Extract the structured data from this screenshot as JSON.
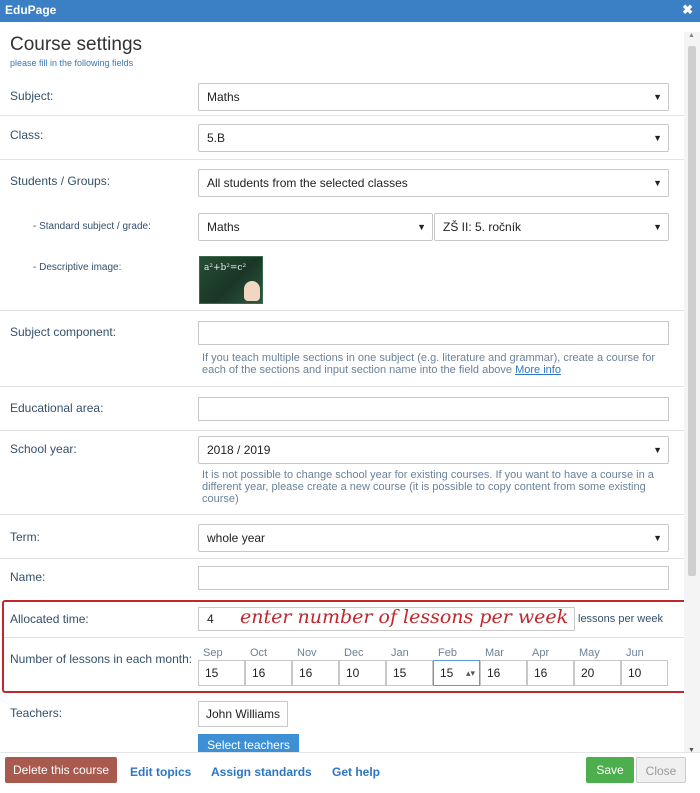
{
  "window": {
    "title": "EduPage"
  },
  "header": {
    "title": "Course settings",
    "subtitle": "please fill in the following fields"
  },
  "fields": {
    "subject": {
      "label": "Subject:",
      "value": "Maths"
    },
    "class": {
      "label": "Class:",
      "value": "5.B"
    },
    "students": {
      "label": "Students / Groups:",
      "value": "All students from the selected classes"
    },
    "standard": {
      "label": "- Standard subject / grade:",
      "subject_value": "Maths",
      "grade_value": "ZŠ II: 5. ročník"
    },
    "image": {
      "label": "- Descriptive image:",
      "chalk_text": "a²+b²=c²"
    },
    "component": {
      "label": "Subject component:",
      "value": "",
      "help": "If you teach multiple sections in one subject (e.g. literature and grammar), create a course for each of the sections and input section name into the field above",
      "help_link": "More info"
    },
    "edu_area": {
      "label": "Educational area:",
      "value": ""
    },
    "school_year": {
      "label": "School year:",
      "value": "2018 / 2019",
      "help": "It is not possible to change school year for existing courses. If you want to have a course in a different year, please create a new course (it is possible to copy content from some existing course)"
    },
    "term": {
      "label": "Term:",
      "value": "whole year"
    },
    "name": {
      "label": "Name:",
      "value": ""
    },
    "allocated": {
      "label": "Allocated time:",
      "value": "4",
      "suffix": "lessons per week",
      "annotation": "enter number of lessons per week"
    },
    "months": {
      "label": "Number of lessons in each month:",
      "items": [
        {
          "m": "Sep",
          "v": "15"
        },
        {
          "m": "Oct",
          "v": "16"
        },
        {
          "m": "Nov",
          "v": "16"
        },
        {
          "m": "Dec",
          "v": "10"
        },
        {
          "m": "Jan",
          "v": "15"
        },
        {
          "m": "Feb",
          "v": "15"
        },
        {
          "m": "Mar",
          "v": "16"
        },
        {
          "m": "Apr",
          "v": "16"
        },
        {
          "m": "May",
          "v": "20"
        },
        {
          "m": "Jun",
          "v": "10"
        }
      ]
    },
    "teachers": {
      "label": "Teachers:",
      "teacher": "John Williams",
      "select_btn": "Select teachers"
    }
  },
  "footer": {
    "delete": "Delete this course",
    "edit_topics": "Edit topics",
    "assign": "Assign standards",
    "help": "Get help",
    "save": "Save",
    "close": "Close"
  },
  "colors": {
    "titlebar": "#3b7fc4",
    "accent_red": "#c0262d",
    "save_green": "#4cae4c",
    "delete_brown": "#a95a4e",
    "select_blue": "#3d8fd6"
  },
  "icons": {
    "close": "close-icon",
    "dropdown": "chevron-down-icon",
    "spinner": "spinner-icon"
  }
}
